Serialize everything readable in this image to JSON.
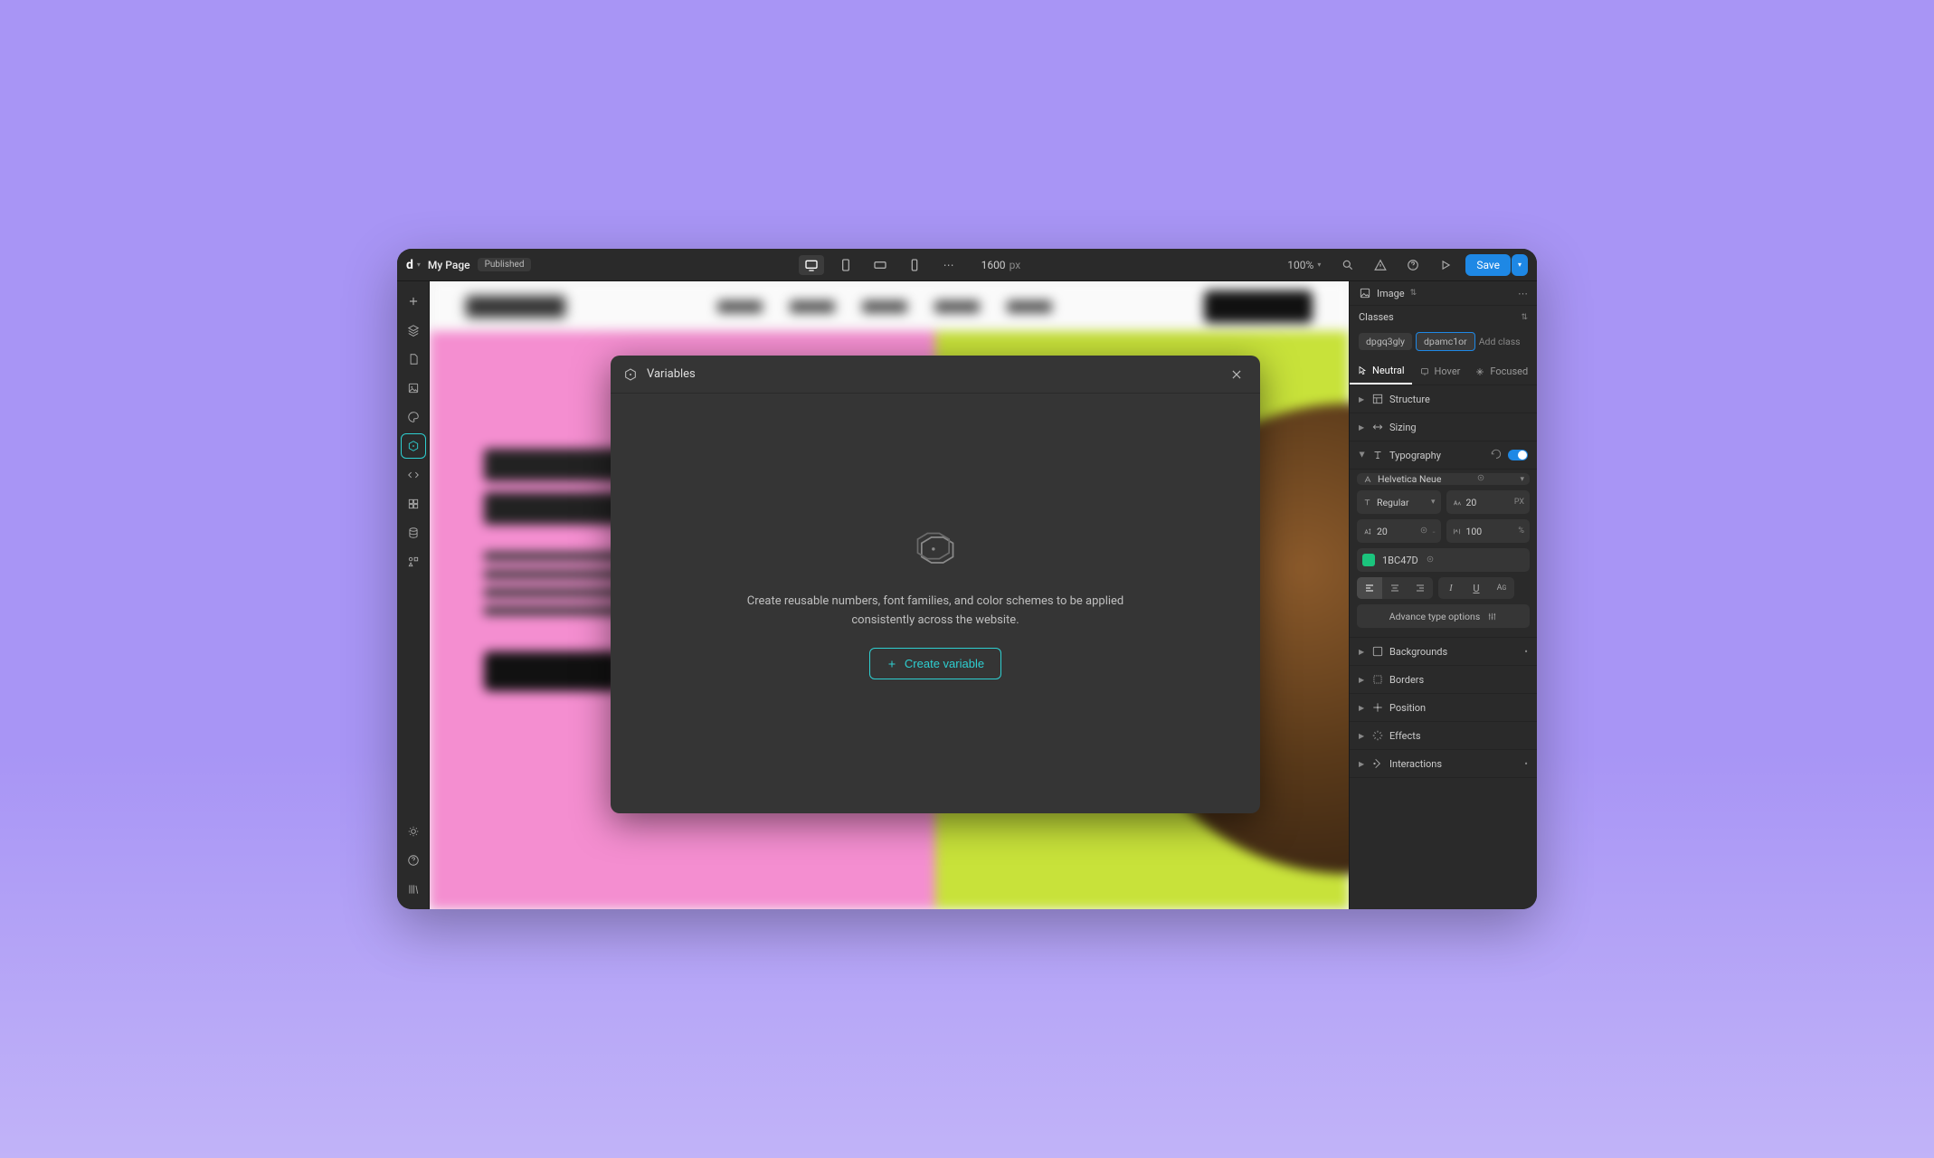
{
  "top": {
    "page_name": "My Page",
    "status_badge": "Published",
    "canvas_width": "1600",
    "canvas_unit": "px",
    "zoom": "100%",
    "save_label": "Save"
  },
  "modal": {
    "title": "Variables",
    "description": "Create reusable numbers, font families, and color schemes to be applied consistently across the website.",
    "create_label": "Create variable"
  },
  "right": {
    "element_label": "Image",
    "classes_label": "Classes",
    "class1": "dpgq3gly",
    "class2": "dpamc1or",
    "add_class_placeholder": "Add class",
    "state_neutral": "Neutral",
    "state_hover": "Hover",
    "state_focused": "Focused",
    "sec_structure": "Structure",
    "sec_sizing": "Sizing",
    "sec_typography": "Typography",
    "font_family": "Helvetica Neue",
    "font_weight": "Regular",
    "font_size": "20",
    "font_size_unit": "PX",
    "line_height": "20",
    "letter_spacing": "100",
    "letter_spacing_unit": "%",
    "color_hex": "1BC47D",
    "color_value": "#1BC47D",
    "adv_type": "Advance type options",
    "sec_backgrounds": "Backgrounds",
    "sec_borders": "Borders",
    "sec_position": "Position",
    "sec_effects": "Effects",
    "sec_interactions": "Interactions"
  },
  "colors": {
    "accent": "#2ecfd1",
    "primary": "#1e88e5"
  }
}
